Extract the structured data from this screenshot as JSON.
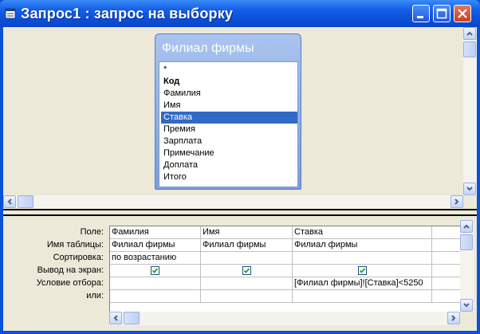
{
  "window": {
    "title": "Запрос1 : запрос на выборку",
    "icon": "query-window-icon",
    "buttons": [
      "minimize-icon",
      "maximize-icon",
      "close-icon"
    ]
  },
  "table": {
    "title": "Филиал фирмы",
    "fields": [
      {
        "label": "*",
        "bold": false,
        "selected": false
      },
      {
        "label": "Код",
        "bold": true,
        "selected": false
      },
      {
        "label": "Фамилия",
        "bold": false,
        "selected": false
      },
      {
        "label": "Имя",
        "bold": false,
        "selected": false
      },
      {
        "label": "Ставка",
        "bold": false,
        "selected": true
      },
      {
        "label": "Премия",
        "bold": false,
        "selected": false
      },
      {
        "label": "Зарплата",
        "bold": false,
        "selected": false
      },
      {
        "label": "Примечание",
        "bold": false,
        "selected": false
      },
      {
        "label": "Доплата",
        "bold": false,
        "selected": false
      },
      {
        "label": "Итого",
        "bold": false,
        "selected": false
      }
    ]
  },
  "grid": {
    "row_labels": [
      "Поле:",
      "Имя таблицы:",
      "Сортировка:",
      "Вывод на экран:",
      "Условие отбора:",
      "или:"
    ],
    "columns": [
      {
        "field": "Фамилия",
        "table": "Филиал фирмы",
        "sort": "по возрастанию",
        "show": true,
        "criteria": "",
        "or": ""
      },
      {
        "field": "Имя",
        "table": "Филиал фирмы",
        "sort": "",
        "show": true,
        "criteria": "",
        "or": ""
      },
      {
        "field": "Ставка",
        "table": "Филиал фирмы",
        "sort": "",
        "show": true,
        "criteria": "[Филиал фирмы]![Ставка]<5250",
        "or": ""
      }
    ]
  },
  "colors": {
    "titlebar": "#0b4fd8",
    "selection": "#316ac5",
    "checkmark": "#21a121"
  }
}
